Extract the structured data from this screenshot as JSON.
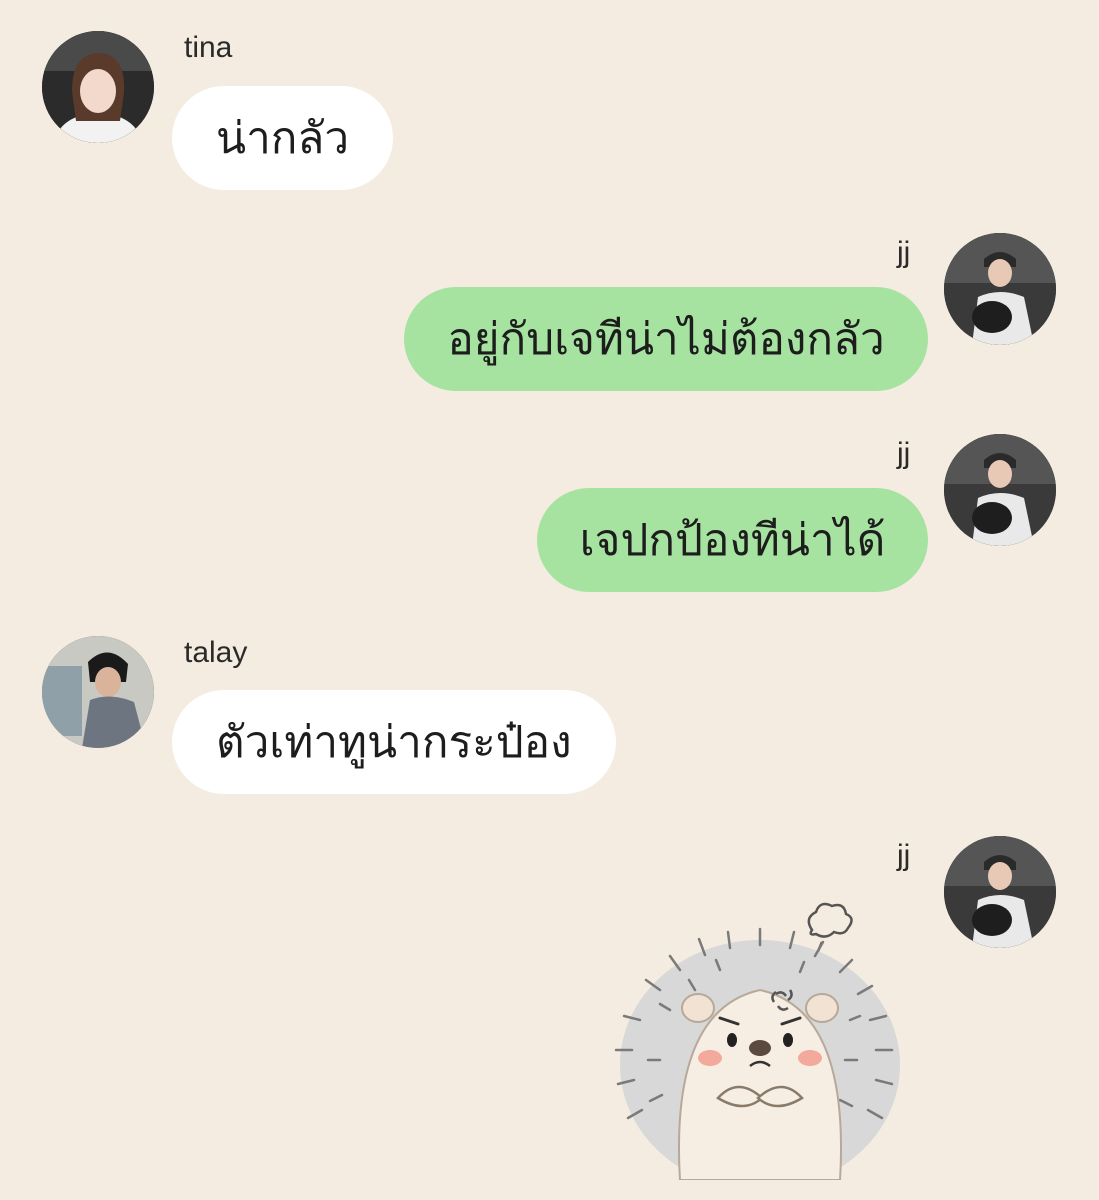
{
  "messages": [
    {
      "sender": "tina",
      "side": "incoming",
      "text": "น่ากลัว"
    },
    {
      "sender": "jj",
      "side": "outgoing",
      "text": "อยู่กับเจทีน่าไม่ต้องกลัว"
    },
    {
      "sender": "jj",
      "side": "outgoing",
      "text": "เจปกป้องทีน่าได้"
    },
    {
      "sender": "talay",
      "side": "incoming",
      "text": "ตัวเท่าทูน่ากระป๋อง"
    },
    {
      "sender": "jj",
      "side": "outgoing",
      "sticker": "angry-hedgehog-sticker"
    }
  ],
  "colors": {
    "background": "#f4ece0",
    "incoming_bubble": "#ffffff",
    "outgoing_bubble": "#a6e3a1"
  }
}
